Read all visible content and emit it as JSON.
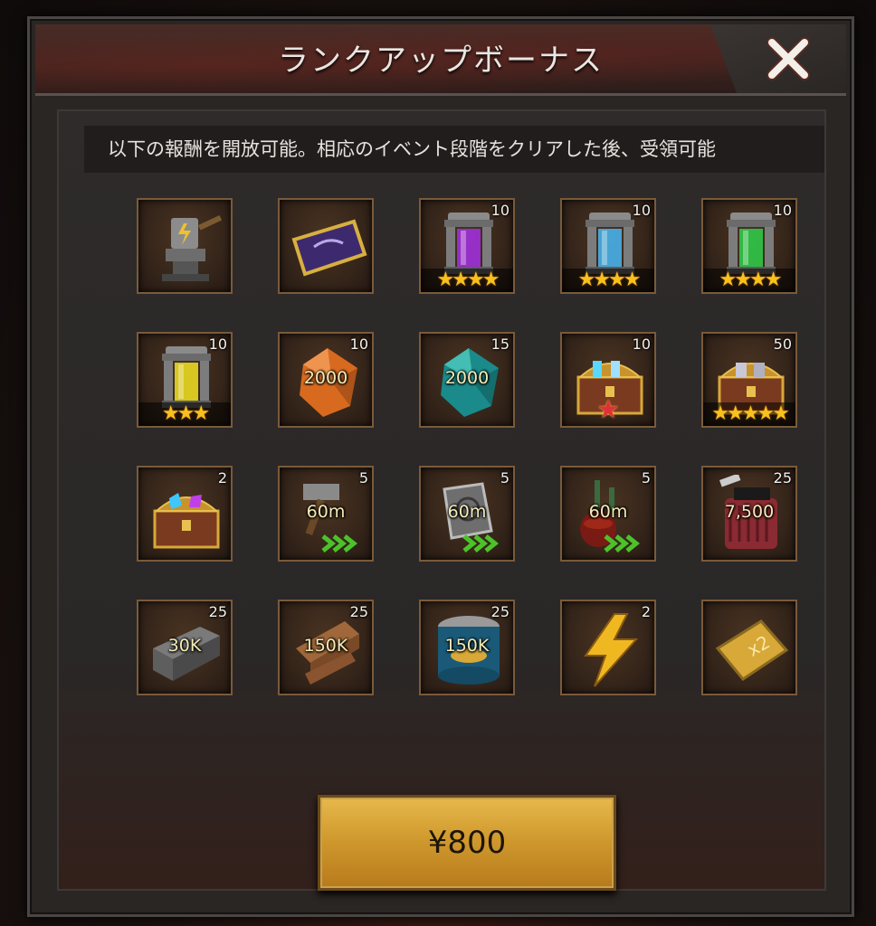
{
  "dialog": {
    "title": "ランクアップボーナス",
    "notice": "以下の報酬を開放可能。相応のイベント段階をクリアした後、受領可能",
    "buy_label": "¥800"
  },
  "rewards": [
    {
      "icon": "anvil-icon",
      "qty": "",
      "label": "",
      "stars": ""
    },
    {
      "icon": "blueprint-icon",
      "qty": "",
      "label": "",
      "stars": ""
    },
    {
      "icon": "purple-capsule-icon",
      "qty": "10",
      "label": "",
      "stars": "★★★★"
    },
    {
      "icon": "blue-capsule-icon",
      "qty": "10",
      "label": "",
      "stars": "★★★★"
    },
    {
      "icon": "green-capsule-icon",
      "qty": "10",
      "label": "",
      "stars": "★★★★"
    },
    {
      "icon": "yellow-capsule-icon",
      "qty": "10",
      "label": "",
      "stars": "★★★"
    },
    {
      "icon": "orange-crystal-icon",
      "qty": "10",
      "label": "2000",
      "stars": ""
    },
    {
      "icon": "teal-crystal-icon",
      "qty": "15",
      "label": "2000",
      "stars": ""
    },
    {
      "icon": "gold-chest-red-star-icon",
      "qty": "10",
      "label": "",
      "stars": "★"
    },
    {
      "icon": "gold-chest-icon",
      "qty": "50",
      "label": "",
      "stars": "★★★★★"
    },
    {
      "icon": "gem-chest-icon",
      "qty": "2",
      "label": "",
      "stars": ""
    },
    {
      "icon": "hammer-speedup-icon",
      "qty": "5",
      "label": "60m",
      "stars": ""
    },
    {
      "icon": "book-speedup-icon",
      "qty": "5",
      "label": "60m",
      "stars": ""
    },
    {
      "icon": "flask-speedup-icon",
      "qty": "5",
      "label": "60m",
      "stars": ""
    },
    {
      "icon": "fuel-can-icon",
      "qty": "25",
      "label": "7,500",
      "stars": ""
    },
    {
      "icon": "steel-icon",
      "qty": "25",
      "label": "30K",
      "stars": ""
    },
    {
      "icon": "wood-icon",
      "qty": "25",
      "label": "150K",
      "stars": ""
    },
    {
      "icon": "food-can-icon",
      "qty": "25",
      "label": "150K",
      "stars": ""
    },
    {
      "icon": "lightning-icon",
      "qty": "2",
      "label": "",
      "stars": ""
    },
    {
      "icon": "x2-ticket-icon",
      "qty": "",
      "label": "",
      "stars": ""
    }
  ]
}
